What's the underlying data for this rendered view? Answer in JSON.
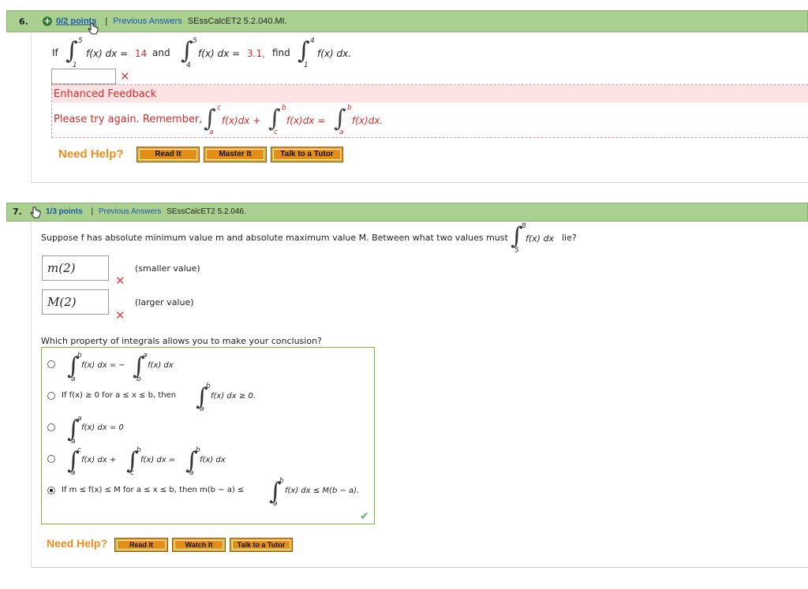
{
  "q6": {
    "number": "6.",
    "points": "0/2 points",
    "sep": "|",
    "prev_answers": "Previous Answers",
    "code": "SEssCalcET2 5.2.040.MI.",
    "text_if": "If",
    "int1": {
      "lower": "1",
      "upper": "5",
      "integrand": "f(x) dx =",
      "value": "14"
    },
    "text_and": "and",
    "int2": {
      "lower": "4",
      "upper": "5",
      "integrand": "f(x) dx =",
      "value": "3.1,"
    },
    "text_find": "find",
    "int3": {
      "lower": "1",
      "upper": "4",
      "integrand": "f(x) dx."
    },
    "answer_value": "",
    "feedback_title": "Enhanced Feedback",
    "feedback_text": "Please try again. Remember,",
    "fb_int1": {
      "lower": "a",
      "upper": "c",
      "integrand": "f(x)dx +"
    },
    "fb_int2": {
      "lower": "c",
      "upper": "b",
      "integrand": "f(x)dx ="
    },
    "fb_int3": {
      "lower": "a",
      "upper": "b",
      "integrand": "f(x)dx."
    },
    "need_help": "Need Help?",
    "btn_read": "Read It",
    "btn_master": "Master It",
    "btn_tutor": "Talk to a Tutor"
  },
  "q7": {
    "number": "7.",
    "points": "1/3 points",
    "sep": "|",
    "prev_answers": "Previous Answers",
    "code": "SEssCalcET2 5.2.046.",
    "question_text": "Suppose f has absolute minimum value m and absolute maximum value M. Between what two values must",
    "q_int": {
      "lower": "5",
      "upper": "8",
      "integrand": "f(x) dx"
    },
    "lie": "lie?",
    "answer1": "m(2)",
    "answer1_label": "(smaller value)",
    "answer2": "M(2)",
    "answer2_label": "(larger value)",
    "property_question": "Which property of integrals allows you to make your conclusion?",
    "options": [
      {
        "a": {
          "lower": "a",
          "upper": "b",
          "integrand": "f(x) dx = −"
        },
        "b": {
          "lower": "b",
          "upper": "a",
          "integrand": "f(x) dx"
        },
        "selected": false
      },
      {
        "prefix": "If f(x) ≥ 0 for a ≤ x ≤ b, then",
        "a": {
          "lower": "a",
          "upper": "b",
          "integrand": "f(x) dx ≥ 0."
        },
        "selected": false
      },
      {
        "a": {
          "lower": "a",
          "upper": "a",
          "integrand": "f(x) dx = 0"
        },
        "selected": false
      },
      {
        "a": {
          "lower": "a",
          "upper": "c",
          "integrand": "f(x) dx +"
        },
        "b": {
          "lower": "c",
          "upper": "b",
          "integrand": "f(x) dx ="
        },
        "c": {
          "lower": "a",
          "upper": "b",
          "integrand": "f(x) dx"
        },
        "selected": false
      },
      {
        "prefix": "If m ≤ f(x) ≤ M for a ≤ x ≤ b, then m(b − a) ≤",
        "a": {
          "lower": "a",
          "upper": "b",
          "integrand": "f(x) dx ≤ M(b − a)."
        },
        "selected": true
      }
    ],
    "need_help": "Need Help?",
    "btn_read": "Read It",
    "btn_watch": "Watch It",
    "btn_tutor": "Talk to a Tutor"
  },
  "icons": {
    "plus": "plus-circle-icon",
    "cursor": "hand-cursor-icon",
    "wrong": "x-mark-icon",
    "correct": "check-mark-icon"
  },
  "colors": {
    "header_bg": "#a9d08e",
    "link": "#1a5aa8",
    "help": "#f28c1e",
    "wrong": "#e0474c",
    "feedback_bg": "#fde3e4",
    "feedback_text": "#d92b2b",
    "correct": "#5cb85c"
  }
}
